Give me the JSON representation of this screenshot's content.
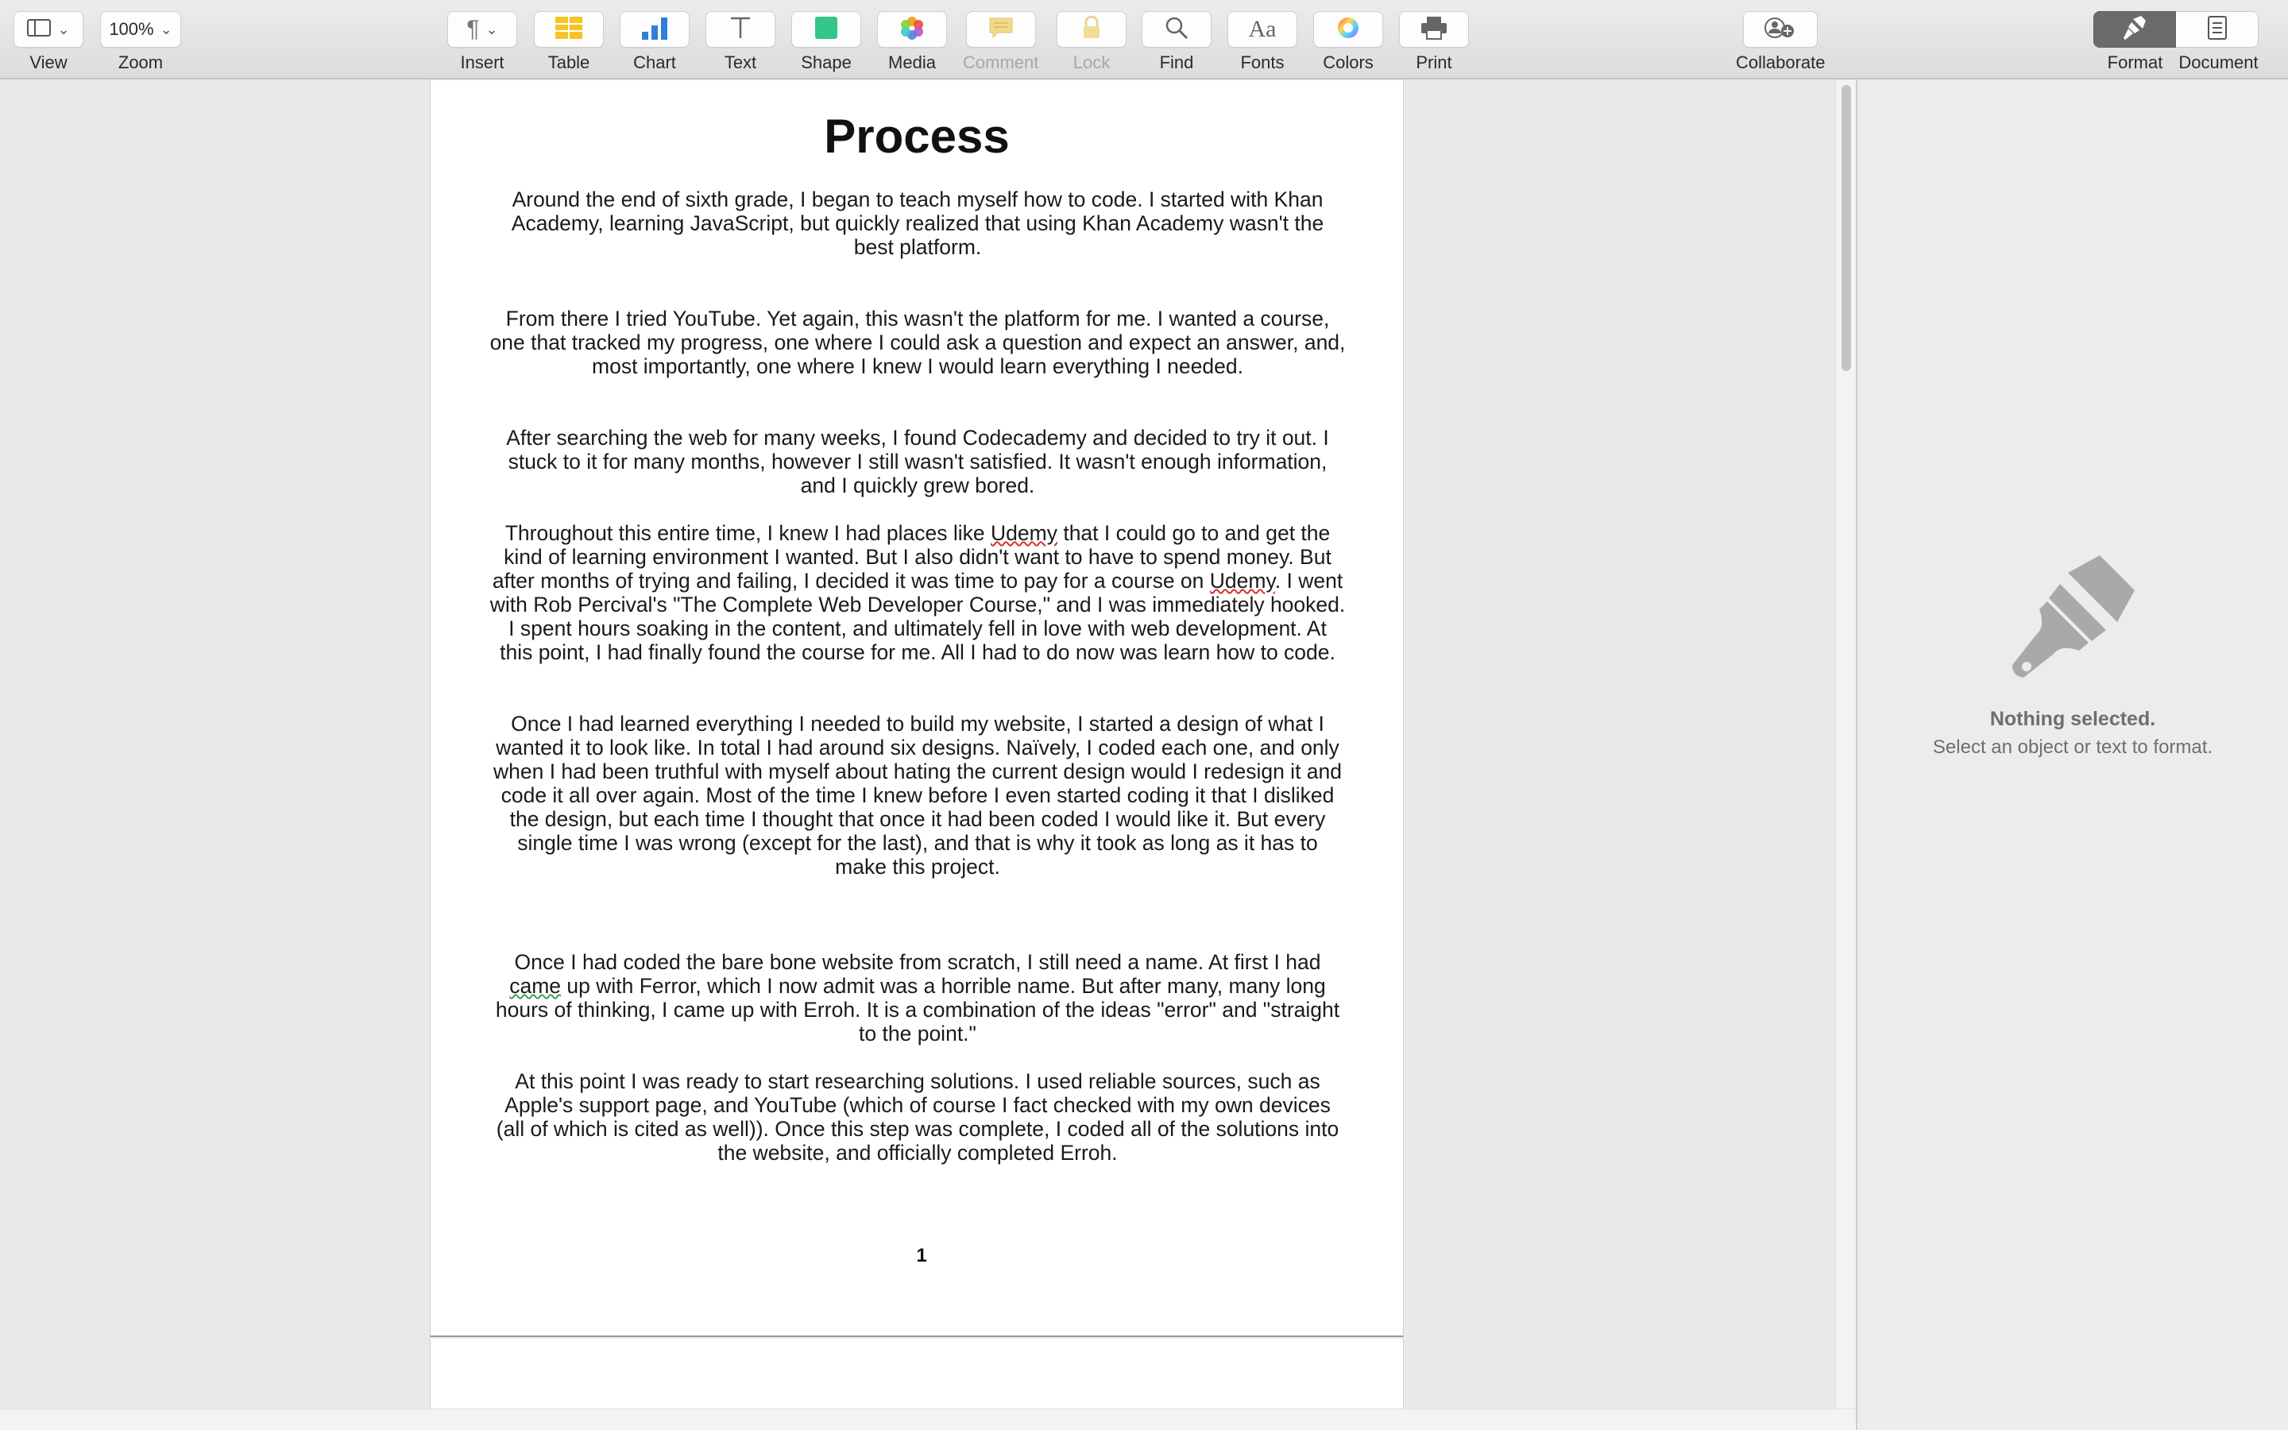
{
  "toolbar": {
    "view": {
      "label": "View"
    },
    "zoom": {
      "label": "Zoom",
      "value": "100%"
    },
    "insert": {
      "label": "Insert"
    },
    "table": {
      "label": "Table"
    },
    "chart": {
      "label": "Chart"
    },
    "text": {
      "label": "Text"
    },
    "shape": {
      "label": "Shape"
    },
    "media": {
      "label": "Media"
    },
    "comment": {
      "label": "Comment"
    },
    "lock": {
      "label": "Lock"
    },
    "find": {
      "label": "Find"
    },
    "fonts": {
      "label": "Fonts",
      "glyph": "Aa"
    },
    "colors": {
      "label": "Colors"
    },
    "print": {
      "label": "Print"
    },
    "collaborate": {
      "label": "Collaborate"
    },
    "format": {
      "label": "Format"
    },
    "document": {
      "label": "Document"
    }
  },
  "document": {
    "title": "Process",
    "paragraphs": {
      "p1": "Around the end of sixth grade, I began to teach myself how to code. I started with Khan Academy, learning JavaScript, but quickly realized that using Khan Academy wasn't the best platform.",
      "p2": "From there I tried YouTube. Yet again, this wasn't the platform for me. I wanted a course, one that tracked my progress, one where I could ask a question and expect an answer, and, most importantly, one where I knew I would learn everything I needed.",
      "p3": "After searching the web for many weeks, I found Codecademy and decided to try it out. I stuck to it for many months, however I still wasn't satisfied. It wasn't enough information, and I quickly grew bored.",
      "p4": {
        "a": "Throughout this entire time, I knew I had places like ",
        "b": "Udemy",
        "c": " that I could go to and get the kind of learning environment I wanted. But I also didn't want to have to spend money. But after months of trying and failing, I decided it was time to pay for a course on ",
        "d": "Udemy",
        "e": ". I went with Rob Percival's \"The Complete Web Developer Course,\" and I was immediately hooked. I spent hours soaking in the content, and ultimately fell in love with web development. At this point, I had finally found the course for me. All I had to do now was learn how to code."
      },
      "p5": "Once I had learned everything I needed to build my website, I started a design of what I wanted it to look like. In total I had around six designs. Naïvely, I coded each one, and only when I had been truthful with myself about hating the current design would I redesign it and code it all over again. Most of the time I knew before I even started coding it that I disliked the design, but each time I thought that once it had been coded I would like it. But every single time I was wrong (except for the last), and that is why it took as long as it has to make this project.",
      "p6": {
        "a": "Once I had coded the bare bone website from scratch, I still need a name. At first I had ",
        "b": "came",
        "c": " up with Ferror, which I now admit was a horrible name. But after many, many long hours of thinking, I came up with Erroh. It is a combination of the ideas \"error\" and \"straight to the point.\""
      },
      "p7": "At this point I was ready to start researching solutions. I used reliable sources, such as Apple's support page, and YouTube (which of course I fact checked with my own devices (all of which is cited as well)). Once this step was complete, I coded all of the solutions into the website, and officially completed Erroh."
    },
    "page_number": "1"
  },
  "inspector": {
    "title": "Nothing selected.",
    "subtitle": "Select an object or text to format."
  },
  "colors": {
    "table_icon": "#f5c524",
    "chart_icon": "#2f7fd8",
    "shape_icon": "#35c48a",
    "comment_icon": "#f1d98a",
    "spelling_underline": "#d8302f",
    "grammar_underline": "#3aa24a",
    "active_segment": "#6b6b6b"
  },
  "icons": [
    "sidebar-icon",
    "pilcrow-icon",
    "table-icon",
    "chart-icon",
    "text-icon",
    "shape-icon",
    "media-icon",
    "comment-icon",
    "lock-icon",
    "search-icon",
    "fonts-icon",
    "color-wheel-icon",
    "printer-icon",
    "collaborate-icon",
    "paintbrush-icon",
    "document-icon"
  ]
}
